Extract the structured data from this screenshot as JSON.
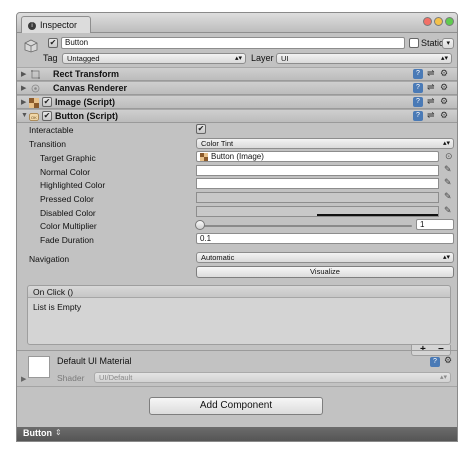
{
  "tab": {
    "title": "Inspector"
  },
  "header": {
    "name_value": "Button",
    "static_label": "Static",
    "tag_label": "Tag",
    "tag_value": "Untagged",
    "layer_label": "Layer",
    "layer_value": "UI"
  },
  "components": {
    "rect_transform": "Rect Transform",
    "canvas_renderer": "Canvas Renderer",
    "image_script": "Image (Script)",
    "button_script": "Button (Script)"
  },
  "button": {
    "interactable_label": "Interactable",
    "transition_label": "Transition",
    "transition_value": "Color Tint",
    "target_graphic_label": "Target Graphic",
    "target_graphic_value": "Button (Image)",
    "normal_color_label": "Normal Color",
    "highlighted_color_label": "Highlighted Color",
    "pressed_color_label": "Pressed Color",
    "disabled_color_label": "Disabled Color",
    "color_multiplier_label": "Color Multiplier",
    "color_multiplier_value": "1",
    "fade_duration_label": "Fade Duration",
    "fade_duration_value": "0.1",
    "navigation_label": "Navigation",
    "navigation_value": "Automatic",
    "visualize_label": "Visualize"
  },
  "on_click": {
    "header": "On Click ()",
    "empty_text": "List is Empty",
    "add_label": "+",
    "remove_label": "−"
  },
  "material": {
    "name": "Default UI Material",
    "shader_label": "Shader",
    "shader_value": "UI/Default"
  },
  "add_component_label": "Add Component",
  "footer": {
    "label": "Button"
  },
  "colors": {
    "panel_bg": "#c2c2c2",
    "field_bg": "#ffffff",
    "help_icon": "#4a7ab6"
  },
  "icons": [
    "info-icon",
    "cube-icon",
    "help-icon",
    "settings-sliders-icon",
    "gear-icon",
    "eyedropper-icon",
    "target-icon",
    "image-icon",
    "button-icon"
  ]
}
